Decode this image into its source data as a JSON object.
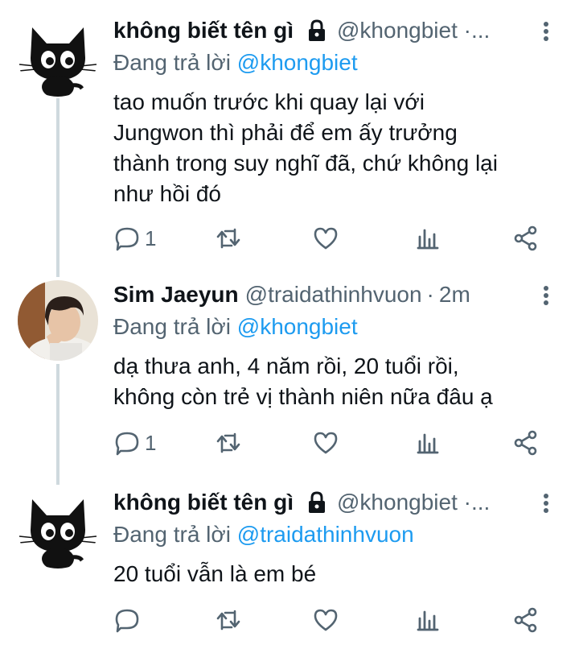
{
  "thread": {
    "tweets": [
      {
        "display_name": "không biết tên gì",
        "handle": "@khongbiet ·...",
        "time": "",
        "locked": true,
        "reply_prefix": "Đang trả lời ",
        "reply_mention": "@khongbiet",
        "text_lines": [
          "tao muốn trước khi quay lại với",
          "Jungwon thì phải để em ấy trưởng",
          "thành trong suy nghĩ đã, chứ không lại",
          "như hồi đó"
        ],
        "reply_count": "1",
        "avatar": "black-cat-avatar"
      },
      {
        "display_name": "Sim Jaeyun",
        "handle": "@traidathinhvuon",
        "time": "2m",
        "locked": false,
        "reply_prefix": "Đang trả lời ",
        "reply_mention": "@khongbiet",
        "text_lines": [
          "dạ thưa anh, 4 năm rồi, 20 tuổi rồi,",
          "không còn trẻ vị thành niên nữa đâu ạ"
        ],
        "reply_count": "1",
        "avatar": "person-photo-avatar"
      },
      {
        "display_name": "không biết tên gì",
        "handle": "@khongbiet ·...",
        "time": "",
        "locked": true,
        "reply_prefix": "Đang trả lời ",
        "reply_mention": "@traidathinhvuon",
        "text_lines": [
          "20 tuổi vẫn là em bé"
        ],
        "reply_count": "",
        "avatar": "black-cat-avatar"
      }
    ],
    "separator": "·",
    "colors": {
      "text": "#0f1419",
      "secondary": "#536471",
      "mention": "#1d9bf0",
      "thread_line": "#cfd9de"
    },
    "icons": [
      "reply-icon",
      "retweet-icon",
      "like-icon",
      "analytics-icon",
      "share-icon",
      "lock-icon",
      "more-icon"
    ]
  }
}
